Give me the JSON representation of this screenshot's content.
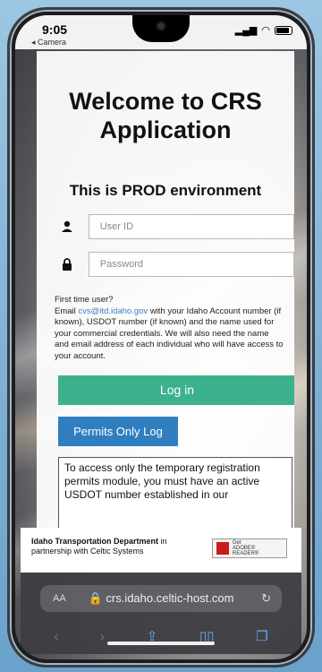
{
  "status_bar": {
    "time": "9:05",
    "back_label": "◂ Camera"
  },
  "login": {
    "title": "Welcome to CRS Application",
    "environment": "This is PROD environment",
    "userid_placeholder": "User ID",
    "password_placeholder": "Password",
    "info_intro": "First time user?",
    "info_email_prefix": "Email ",
    "info_email": "cvs@itd.idaho.gov",
    "info_text": " with your Idaho Account number (if known), USDOT number (if known) and the name used for your commercial credentials. We will also need the name and email address of each individual who will have access to your account.",
    "login_button": "Log in",
    "permits_button": "Permits Only Log",
    "permits_text": "To access only the temporary registration permits module, you must have an active USDOT number   established in our"
  },
  "footer": {
    "org": "Idaho Transportation Department",
    "org_suffix": " in",
    "partner": "partnership with Celtic Systems",
    "badge_line1": "Get",
    "badge_line2": "ADOBE® READER®"
  },
  "browser": {
    "aa": "AA",
    "url": "crs.idaho.celtic-host.com",
    "icons": [
      "back-icon",
      "forward-icon",
      "share-icon",
      "bookmarks-icon",
      "tabs-icon"
    ]
  },
  "colors": {
    "login_button": "#3db08e",
    "permits_button": "#2f7fc0",
    "link": "#3a7fc0"
  }
}
